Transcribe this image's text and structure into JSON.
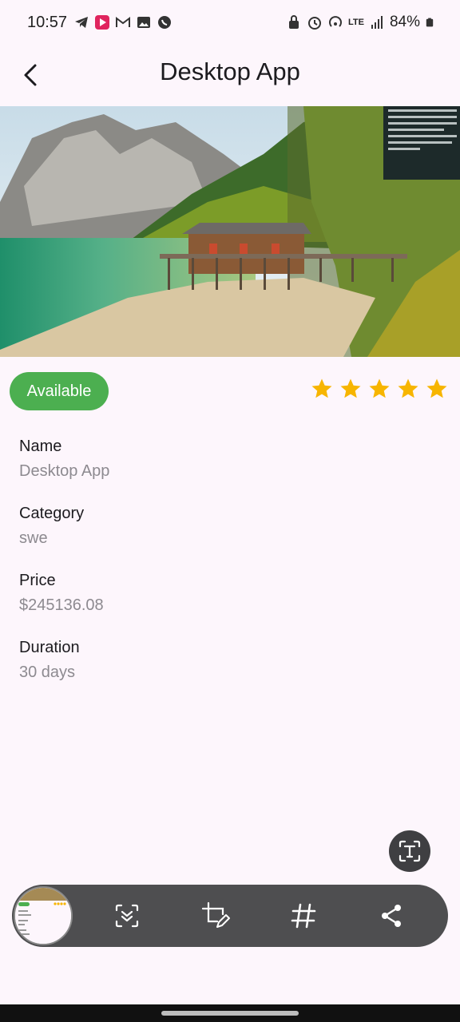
{
  "status_bar": {
    "time": "10:57",
    "battery": "84%",
    "network": "LTE",
    "left_icons": [
      "telegram-icon",
      "video-app-icon",
      "gmail-icon",
      "gallery-icon",
      "whatsapp-icon"
    ],
    "right_icons": [
      "lock-icon",
      "alarm-icon",
      "hotspot-icon",
      "lte-icon",
      "signal-icon",
      "battery-icon"
    ]
  },
  "app_bar": {
    "title": "Desktop App",
    "back_icon": "arrow-back-icon"
  },
  "product": {
    "status": "Available",
    "status_color": "#4caf50",
    "rating": 5,
    "rating_max": 5,
    "star_color": "#f7b500",
    "fields": [
      {
        "label": "Name",
        "value": "Desktop App"
      },
      {
        "label": "Category",
        "value": "swe"
      },
      {
        "label": "Price",
        "value": "$245136.08"
      },
      {
        "label": "Duration",
        "value": "30 days"
      }
    ]
  },
  "screenshot_toolbar": {
    "items": [
      "thumbnail",
      "scroll-capture-icon",
      "crop-edit-icon",
      "hashtag-icon",
      "share-icon"
    ],
    "extract_text_icon": "text-extract-icon"
  }
}
